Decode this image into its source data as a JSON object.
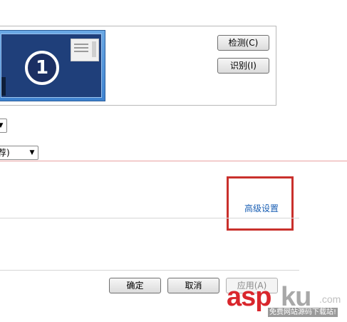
{
  "monitor": {
    "number": "1"
  },
  "buttons": {
    "detect": "检测(C)",
    "identify": "识别(I)",
    "ok": "确定",
    "cancel": "取消",
    "apply": "应用(A)"
  },
  "combos": {
    "orientation_value": "",
    "resolution_value": "荐)"
  },
  "links": {
    "advanced": "高级设置"
  },
  "watermark": {
    "brand_asp": "asp",
    "brand_ku": "ku",
    "suffix": ".com",
    "tagline": "免费网站源码下载站!"
  },
  "colors": {
    "highlight": "#c9302c",
    "link": "#1a5fb4",
    "watermark_red": "#d9262c"
  }
}
